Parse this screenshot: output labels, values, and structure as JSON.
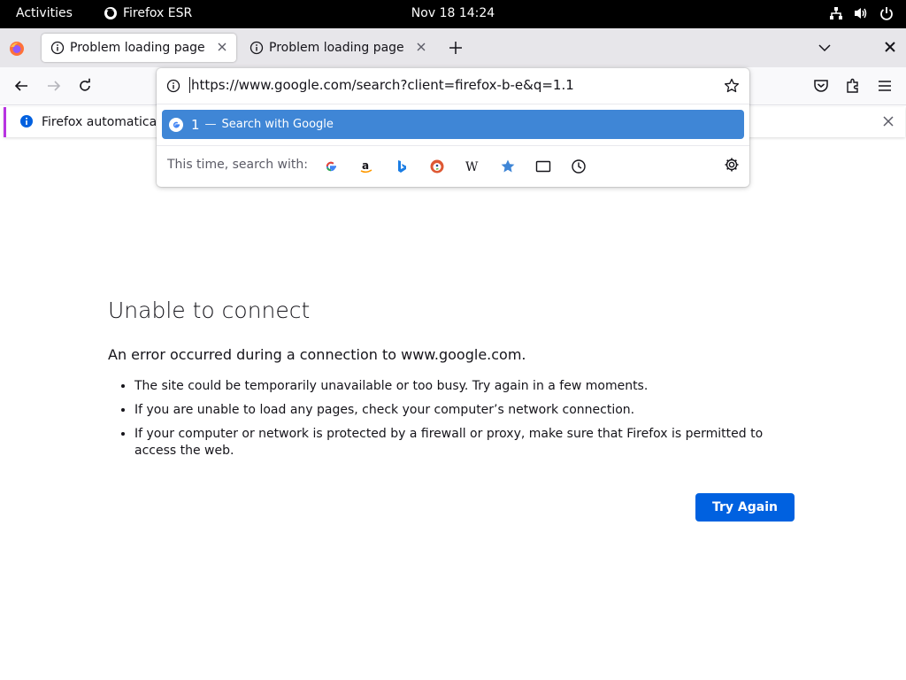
{
  "topbar": {
    "activities": "Activities",
    "app_name": "Firefox ESR",
    "clock": "Nov 18  14:24",
    "tray_icons": [
      "network-icon",
      "volume-icon",
      "power-icon"
    ]
  },
  "tabs": [
    {
      "title": "Problem loading page",
      "active": true
    },
    {
      "title": "Problem loading page",
      "active": false
    }
  ],
  "urlbar": {
    "url": "https://www.google.com/search?client=firefox-b-e&q=1.1",
    "suggestion": {
      "query": "1",
      "dash": "—",
      "action": "Search with Google"
    },
    "one_off_label": "This time, search with:",
    "engines": [
      "Google",
      "Amazon",
      "Bing",
      "DuckDuckGo",
      "Wikipedia",
      "Bookmarks",
      "Tabs",
      "History"
    ]
  },
  "notification": {
    "text": "Firefox automatically"
  },
  "error": {
    "title": "Unable to connect",
    "description": "An error occurred during a connection to www.google.com.",
    "items": [
      "The site could be temporarily unavailable or too busy. Try again in a few moments.",
      "If you are unable to load any pages, check your computer’s network connection.",
      "If your computer or network is protected by a firewall or proxy, make sure that Firefox is permitted to access the web."
    ],
    "button": "Try Again"
  },
  "colors": {
    "accent": "#0061e0",
    "selection": "#3f86d6",
    "topbar": "#000000",
    "tabstrip": "#e7e6ea"
  }
}
